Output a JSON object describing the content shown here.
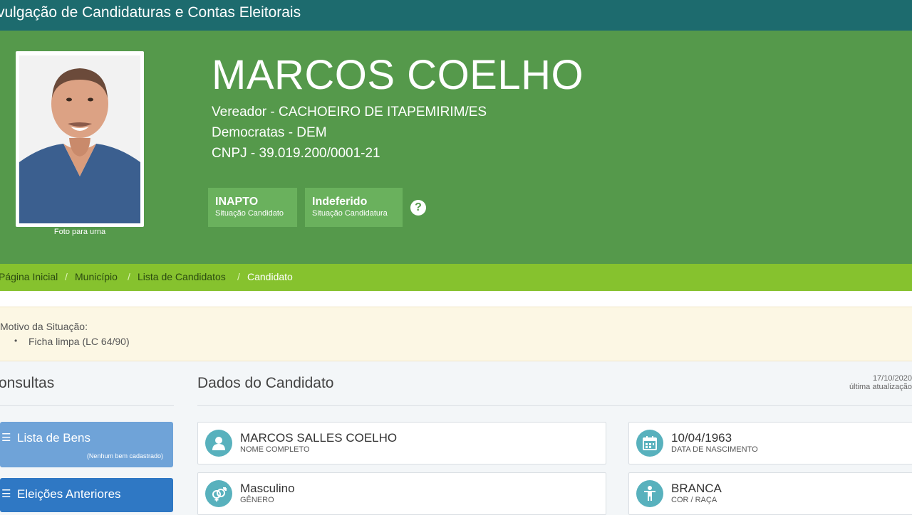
{
  "header": {
    "title": "vulgação de Candidaturas e Contas Eleitorais"
  },
  "candidate": {
    "name": "MARCOS COELHO",
    "office": "Vereador - CACHOEIRO DE ITAPEMIRIM/ES",
    "party": "Democratas - DEM",
    "cnpj": "CNPJ - 39.019.200/0001-21",
    "photo_caption": "Foto para urna",
    "status": [
      {
        "value": "INAPTO",
        "label": "Situação Candidato"
      },
      {
        "value": "Indeferido",
        "label": "Situação Candidatura"
      }
    ],
    "help_icon": "question-circle-icon"
  },
  "breadcrumb": {
    "items": [
      "Página Inicial",
      "Município",
      "Lista de Candidatos",
      "Candidato"
    ],
    "separator": "/"
  },
  "motive": {
    "title": "Motivo da Situação:",
    "items": [
      "Ficha limpa (LC 64/90)"
    ]
  },
  "sidebar": {
    "title": "onsultas",
    "buttons": [
      {
        "label": "Lista de Bens",
        "sub": "(Nenhum bem cadastrado)",
        "icon": "list-icon",
        "color": "#6fa3d8"
      },
      {
        "label": "Eleições Anteriores",
        "sub": "",
        "icon": "list-icon",
        "color": "#2f78c4"
      }
    ]
  },
  "main": {
    "title": "Dados do Candidato",
    "updated_date": "17/10/2020",
    "updated_label": "última atualização",
    "fields": [
      {
        "value": "MARCOS SALLES COELHO",
        "label": "NOME COMPLETO",
        "icon": "user-icon"
      },
      {
        "value": "10/04/1963",
        "label": "DATA DE NASCIMENTO",
        "icon": "calendar-icon"
      },
      {
        "value": "Masculino",
        "label": "GÊNERO",
        "icon": "gender-icon"
      },
      {
        "value": "BRANCA",
        "label": "COR / RAÇA",
        "icon": "person-icon"
      }
    ]
  },
  "colors": {
    "topbar": "#1d6b6e",
    "hero": "#55994b",
    "badge": "#6ab15d",
    "breadcrumb_bar": "#86c22e",
    "icon_circle": "#58b1bd"
  }
}
